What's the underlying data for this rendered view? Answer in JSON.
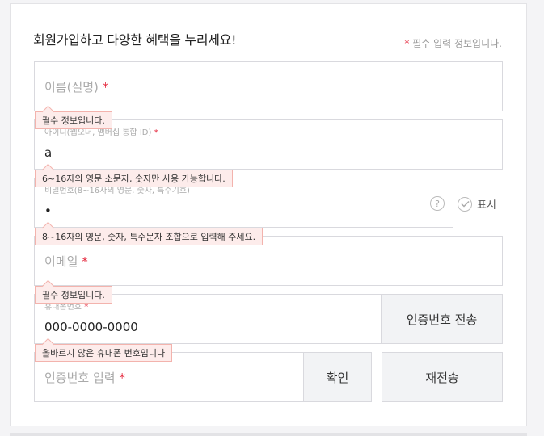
{
  "header": {
    "title": "회원가입하고 다양한 혜택을 누리세요!",
    "required_star": "*",
    "required_note": "필수 입력 정보입니다."
  },
  "fields": {
    "name": {
      "placeholder": "이름(실명)",
      "star": "*",
      "error": "필수 정보입니다."
    },
    "user_id": {
      "label": "아이디(웹오더, 멤버십 통합 ID)",
      "star": "*",
      "value": "a",
      "error": "6~16자의 영문 소문자, 숫자만 사용 가능합니다."
    },
    "password": {
      "label": "비밀번호(8~16자의 영문, 숫자, 특수기호)",
      "value": "•",
      "help": "?",
      "show_label": "표시",
      "error": "8~16자의 영문, 숫자, 특수문자 조합으로 입력해 주세요."
    },
    "email": {
      "placeholder": "이메일",
      "star": "*",
      "error": "필수 정보입니다."
    },
    "phone": {
      "label": "휴대폰번호",
      "star": "*",
      "value": "000-0000-0000",
      "send_button": "인증번호 전송",
      "error": "올바르지 않은 휴대폰 번호입니다"
    },
    "auth_code": {
      "placeholder": "인증번호 입력",
      "star": "*",
      "confirm_button": "확인",
      "resend_button": "재전송"
    }
  },
  "colors": {
    "required": "#e5293e",
    "error_bg": "#fdeceb",
    "error_border": "#f3b3ad"
  }
}
